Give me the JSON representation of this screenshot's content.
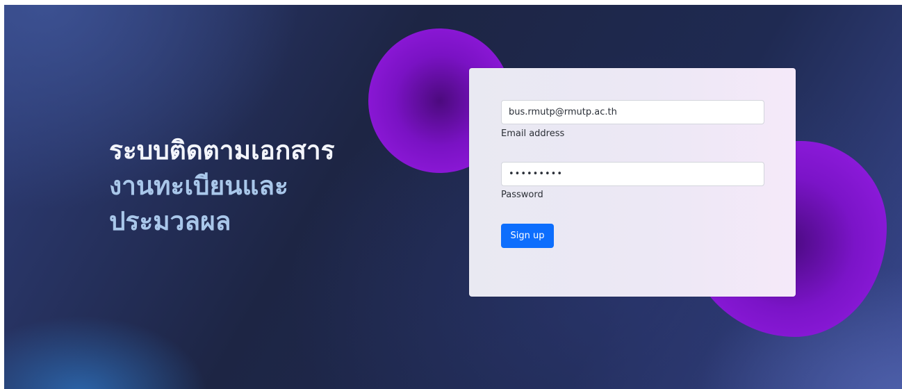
{
  "hero": {
    "title_line1": "ระบบติดตามเอกสาร",
    "title_line2": "งานทะเบียนและ",
    "title_line3": "ประมวลผล"
  },
  "form": {
    "email_value": "bus.rmutp@rmutp.ac.th",
    "email_label": "Email address",
    "password_value": "•••••••••",
    "password_label": "Password",
    "submit_label": "Sign up"
  },
  "colors": {
    "accent": "#0d6efd",
    "blob": "#9a1de6",
    "headline_primary": "#f3f5fb",
    "headline_secondary": "#a9c7ea"
  }
}
